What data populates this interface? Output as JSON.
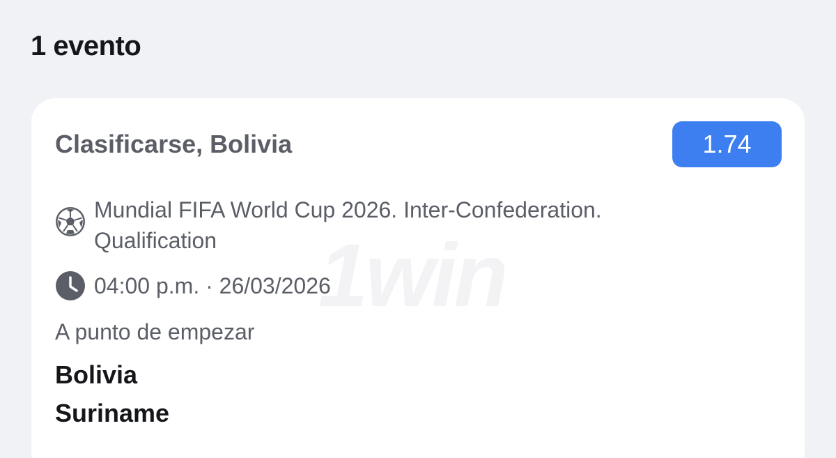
{
  "header": {
    "event_count": "1 evento"
  },
  "card": {
    "bet_title": "Clasificarse, Bolivia",
    "odds": "1.74",
    "watermark": "1win",
    "tournament": {
      "icon": "soccer-ball-icon",
      "text": "Mundial FIFA World Cup 2026. Inter-Confederation. Qualification"
    },
    "time": {
      "icon": "clock-icon",
      "text": "04:00 p.m. · 26/03/2026"
    },
    "status": "A punto de empezar",
    "teams": {
      "home": "Bolivia",
      "away": "Suriname"
    }
  },
  "colors": {
    "background": "#f1f2f6",
    "card": "#ffffff",
    "accent": "#3d7ff0",
    "primary_text": "#15161a",
    "secondary_text": "#5b5e66"
  }
}
